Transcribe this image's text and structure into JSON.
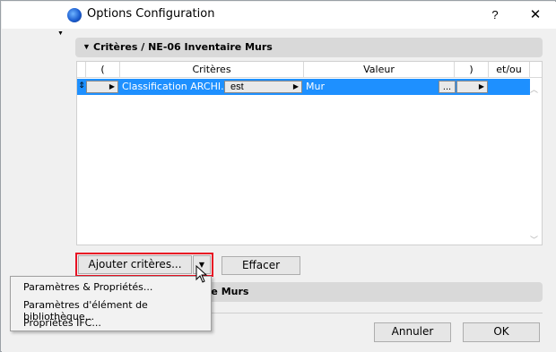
{
  "window": {
    "title": "Options Configuration",
    "help_label": "?",
    "close_label": "✕"
  },
  "sections": {
    "criteria_title": "Critères / NE-06 Inventaire Murs",
    "second_title_partial": "re Murs"
  },
  "table": {
    "headers": {
      "open_paren": "(",
      "criteria": "Critères",
      "value": "Valeur",
      "close_paren": ")",
      "and_or": "et/ou"
    },
    "rows": [
      {
        "criteria": "Classification ARCHI...",
        "operator": "est",
        "value": "Mur",
        "ellipsis": "..."
      }
    ]
  },
  "buttons": {
    "add_criteria": "Ajouter critères...",
    "clear": "Effacer",
    "cancel": "Annuler",
    "ok": "OK"
  },
  "menu": {
    "items": [
      "Paramètres & Propriétés...",
      "Paramètres d'élément de bibliothèque...",
      "Propriétés IFC..."
    ]
  },
  "colors": {
    "selection": "#1e90ff",
    "highlight_frame": "#e81123"
  }
}
